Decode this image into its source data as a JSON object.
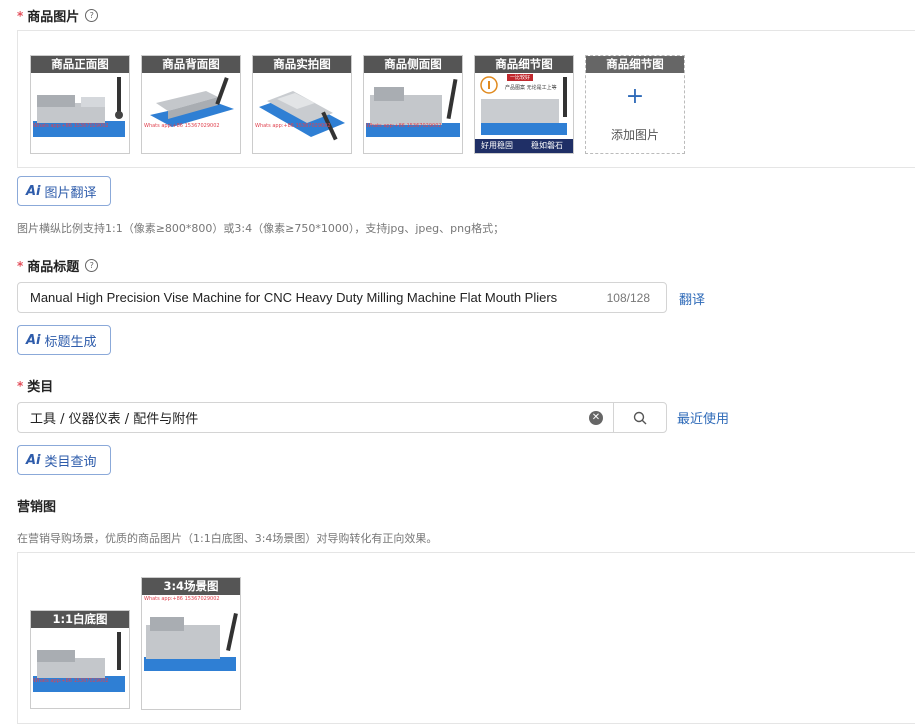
{
  "product_images": {
    "label": "商品图片",
    "required_mark": "*",
    "help_icon": "question-circle-icon",
    "items": [
      {
        "caption": "商品正面图",
        "watermark": "Whats app:+86 15367029002"
      },
      {
        "caption": "商品背面图",
        "watermark": "Whats app:+86 15367029002"
      },
      {
        "caption": "商品实拍图",
        "watermark": "Whats app:+86 15367029002"
      },
      {
        "caption": "商品侧面图",
        "watermark": "Whats app:+86 15367029002"
      },
      {
        "caption": "商品细节图",
        "overlay_top": "一比较好",
        "overlay_side": "产品图案 无论是工上等",
        "bottom_left": "好用稳固",
        "bottom_right": "稳如磐石"
      }
    ],
    "add": {
      "caption": "商品细节图",
      "label": "添加图片"
    },
    "translate_button": "图片翻译",
    "hint": "图片横纵比例支持1:1（像素≥800*800）或3:4（像素≥750*1000），支持jpg、jpeg、png格式；"
  },
  "title_field": {
    "label": "商品标题",
    "required_mark": "*",
    "value": "Manual High Precision Vise Machine for CNC Heavy Duty Milling Machine Flat Mouth Pliers",
    "counter": "108/128",
    "translate_link": "翻译",
    "generate_button": "标题生成"
  },
  "category_field": {
    "label": "类目",
    "required_mark": "*",
    "value": "工具 / 仪器仪表 / 配件与附件",
    "recent_link": "最近使用",
    "query_button": "类目查询"
  },
  "marketing": {
    "label": "营销图",
    "hint": "在营销导购场景，优质的商品图片（1:1白底图、3:4场景图）对导购转化有正向效果。",
    "items": [
      {
        "caption": "1:1白底图",
        "watermark": "Whats app:+86 15367029002"
      },
      {
        "caption": "3:4场景图",
        "watermark": "Whats app:+86 15367029002"
      }
    ]
  },
  "ai_mark": "Ai",
  "colors": {
    "accent": "#2e6ab8",
    "required": "#e34d59",
    "vise_blue": "#2f7fd4",
    "vise_metal": "#b9bcc0"
  }
}
